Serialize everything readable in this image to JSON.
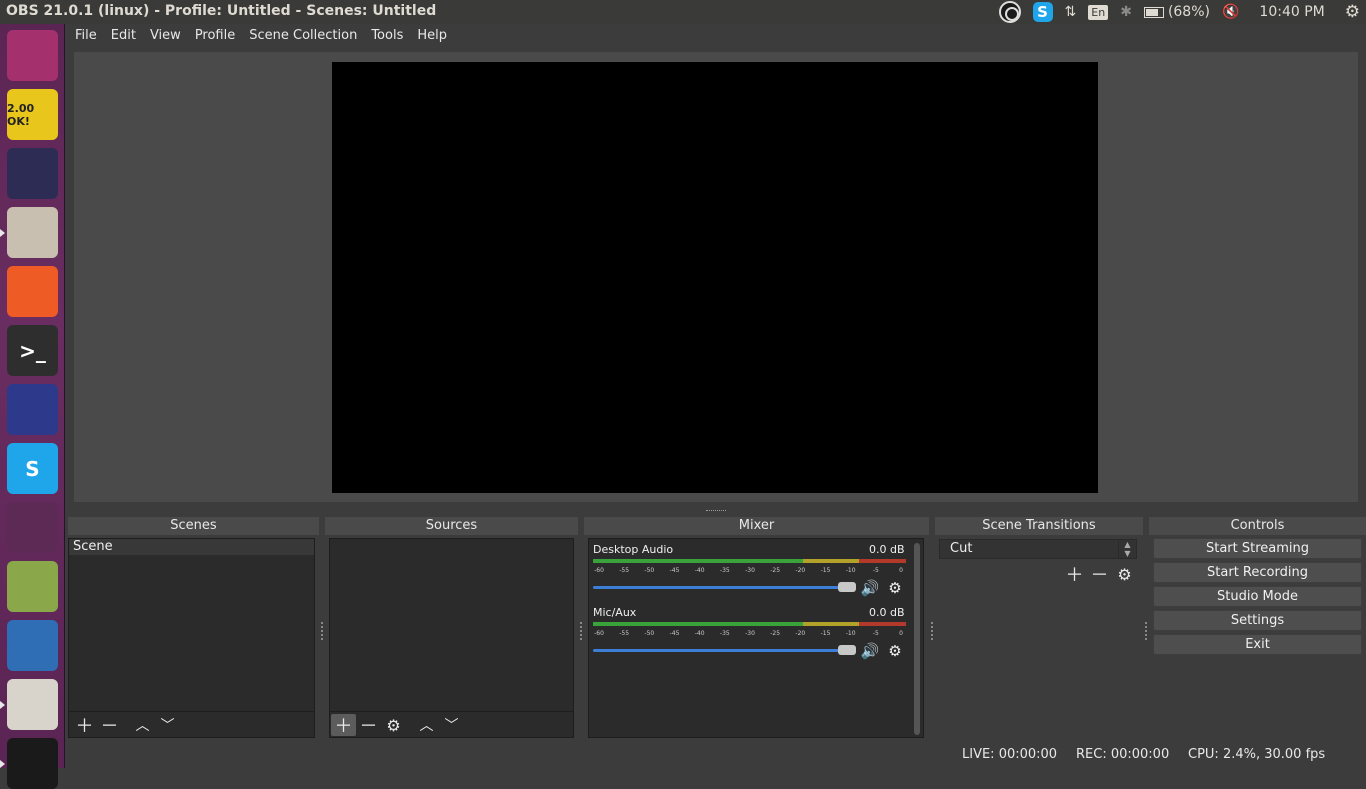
{
  "window": {
    "title": "OBS 21.0.1 (linux) - Profile: Untitled - Scenes: Untitled"
  },
  "tray": {
    "skype_glyph": "S",
    "language": "En",
    "battery": "(68%)",
    "time": "10:40 PM"
  },
  "launcher": {
    "items": [
      {
        "name": "ubuntu-dash-icon",
        "label": "",
        "bg": "#a4306e"
      },
      {
        "name": "stickynotes-icon",
        "label": "2.00 OK!",
        "bg": "#e9c61c"
      },
      {
        "name": "vscode-icon",
        "label": "",
        "bg": "#2c2c54"
      },
      {
        "name": "file-cabinet-icon",
        "label": "",
        "bg": "#c9bfb1"
      },
      {
        "name": "postman-icon",
        "label": "",
        "bg": "#ef5b25"
      },
      {
        "name": "terminal-icon",
        "label": ">_",
        "bg": "#2e2e2e"
      },
      {
        "name": "firefox-icon",
        "label": "",
        "bg": "#2d3a8c"
      },
      {
        "name": "skype-icon",
        "label": "S",
        "bg": "#1fa5e9"
      },
      {
        "name": "chrome-icon",
        "label": "",
        "bg": "#5d2a55"
      },
      {
        "name": "image-viewer-icon",
        "label": "",
        "bg": "#8aa84a"
      },
      {
        "name": "libreoffice-writer-icon",
        "label": "",
        "bg": "#2f6db5"
      },
      {
        "name": "text-editor-icon",
        "label": "",
        "bg": "#d8d4cc"
      },
      {
        "name": "obs-icon",
        "label": "",
        "bg": "#1a1a1a"
      }
    ]
  },
  "menu": {
    "items": [
      {
        "label": "File"
      },
      {
        "label": "Edit"
      },
      {
        "label": "View"
      },
      {
        "label": "Profile"
      },
      {
        "label": "Scene Collection"
      },
      {
        "label": "Tools"
      },
      {
        "label": "Help"
      }
    ]
  },
  "docks": {
    "scenes": {
      "title": "Scenes",
      "items": [
        "Scene"
      ]
    },
    "sources": {
      "title": "Sources"
    },
    "mixer": {
      "title": "Mixer",
      "channels": [
        {
          "name": "Desktop Audio",
          "db": "0.0 dB",
          "volume_fraction": 1.0
        },
        {
          "name": "Mic/Aux",
          "db": "0.0 dB",
          "volume_fraction": 1.0
        }
      ],
      "ticks": [
        "-60",
        "-55",
        "-50",
        "-45",
        "-40",
        "-35",
        "-30",
        "-25",
        "-20",
        "-15",
        "-10",
        "-5",
        "0"
      ]
    },
    "transitions": {
      "title": "Scene Transitions",
      "selected": "Cut"
    },
    "controls": {
      "title": "Controls",
      "buttons": [
        "Start Streaming",
        "Start Recording",
        "Studio Mode",
        "Settings",
        "Exit"
      ]
    }
  },
  "status": {
    "live": "LIVE: 00:00:00",
    "rec": "REC: 00:00:00",
    "cpu": "CPU: 2.4%, 30.00 fps"
  },
  "colors": {
    "meter_green": "#3aa23a",
    "meter_yellow": "#b3a22a",
    "meter_red": "#b33a2a",
    "volume_blue": "#3d7fd6"
  }
}
